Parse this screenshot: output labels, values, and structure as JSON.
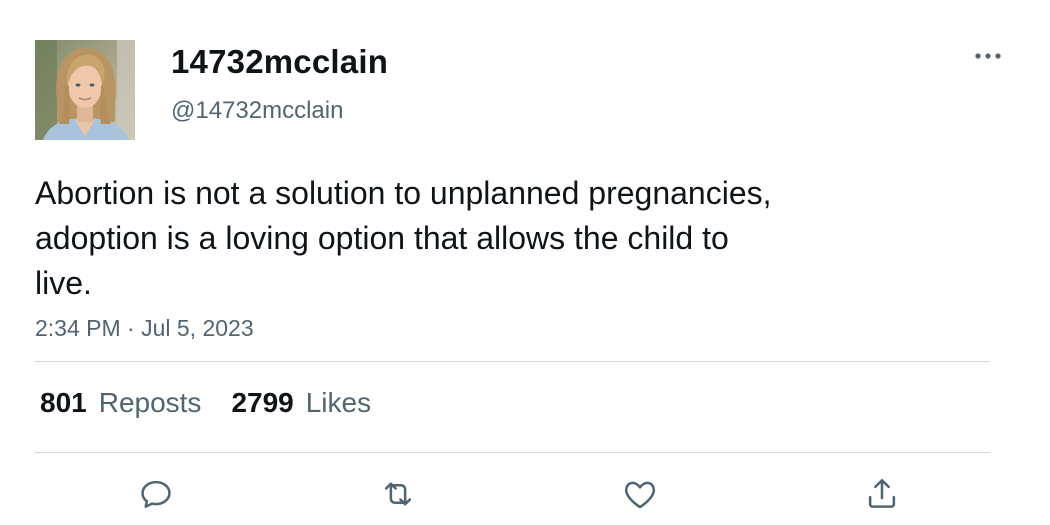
{
  "user": {
    "display_name": "14732mcclain",
    "handle": "@14732mcclain"
  },
  "tweet": {
    "text": "Abortion is not a solution to unplanned pregnancies,\nadoption is a loving option that allows the child to\nlive.",
    "timestamp": "2:34 PM · Jul 5, 2023"
  },
  "stats": {
    "reposts_count": "801",
    "reposts_label": "Reposts",
    "likes_count": "2799",
    "likes_label": "Likes"
  },
  "icons": {
    "more": "more-horizontal-icon",
    "reply": "reply-icon",
    "repost": "repost-icon",
    "like": "heart-icon",
    "share": "share-icon"
  },
  "colors": {
    "text_primary": "#0f1419",
    "text_secondary": "#536471",
    "divider": "#cfd9de"
  }
}
